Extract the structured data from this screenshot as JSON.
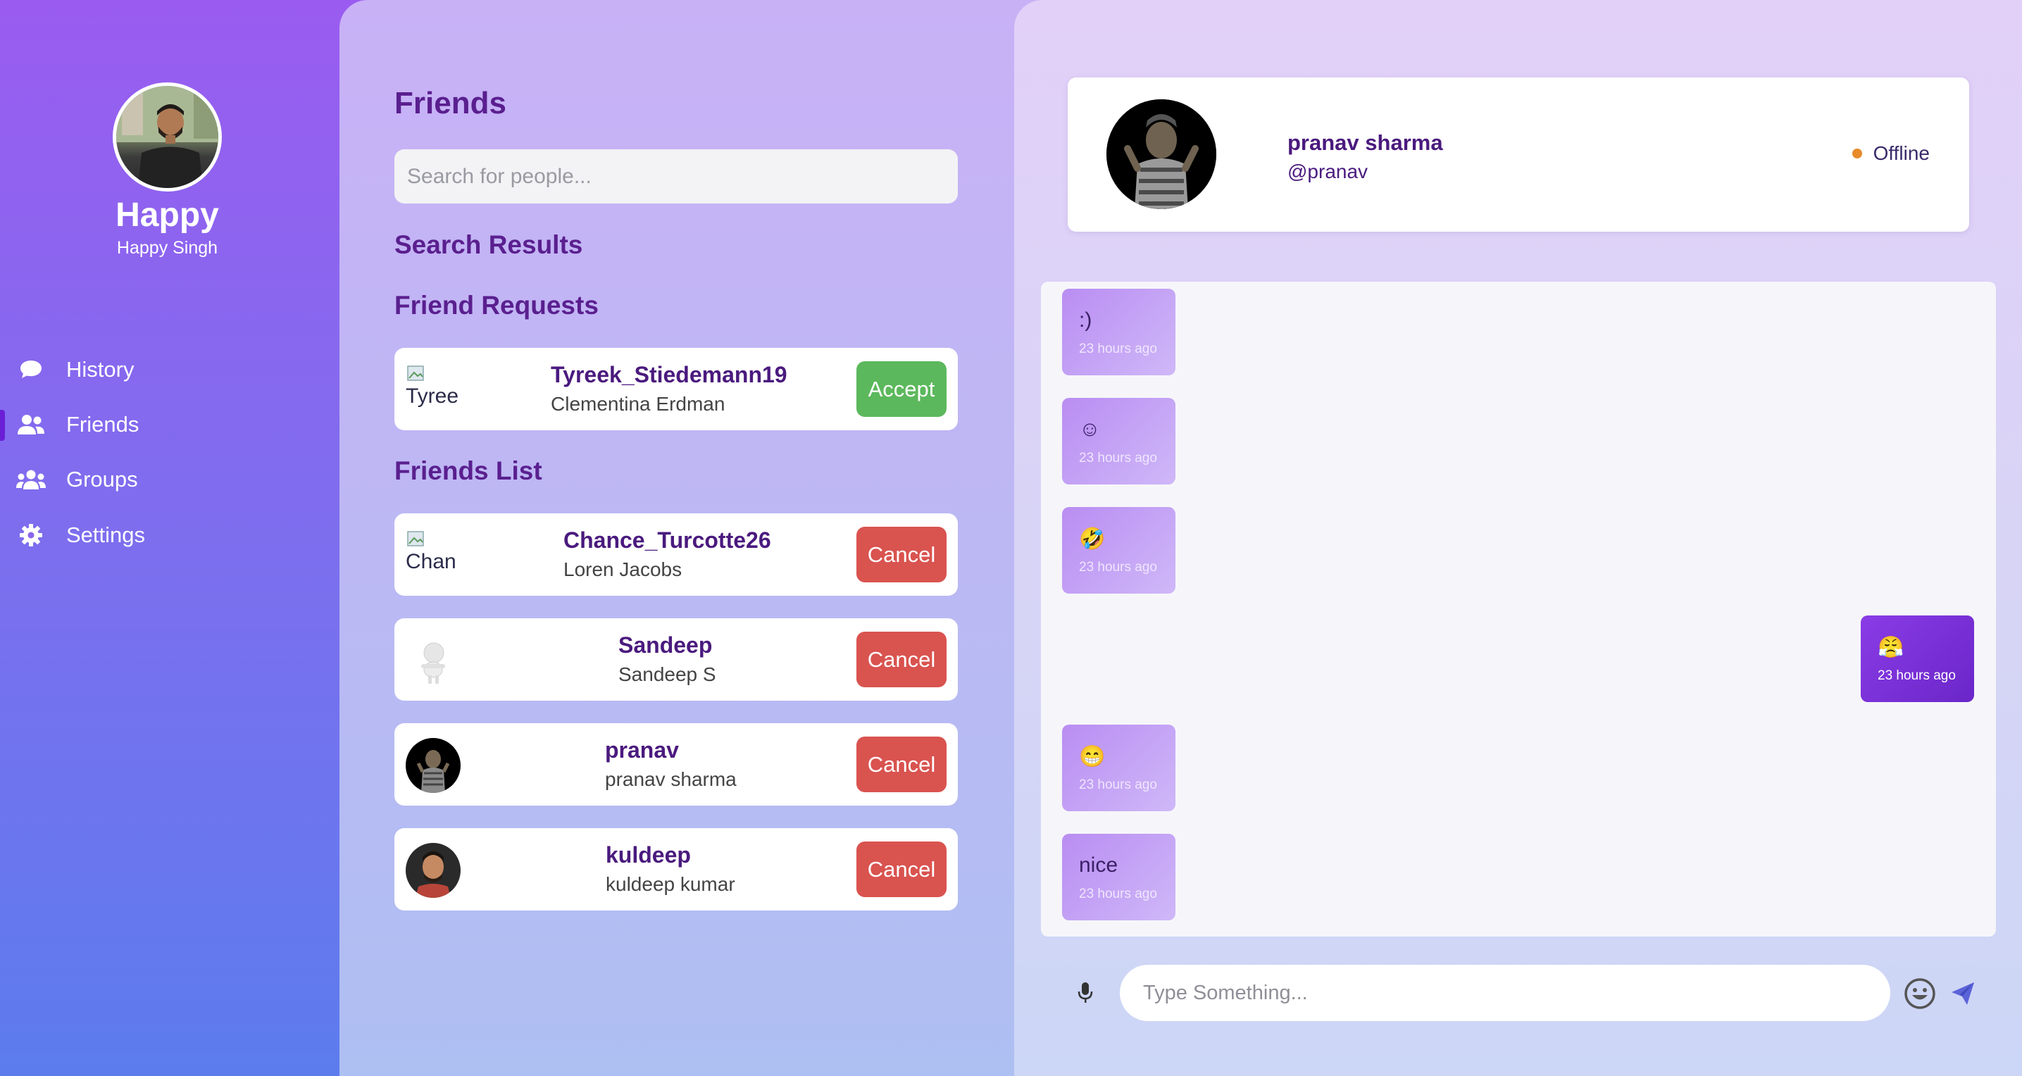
{
  "user": {
    "display_name": "Happy",
    "full_name": "Happy Singh"
  },
  "nav": [
    {
      "label": "History",
      "icon": "chat-bubble-icon"
    },
    {
      "label": "Friends",
      "icon": "user-friends-icon",
      "active": true
    },
    {
      "label": "Groups",
      "icon": "users-icon"
    },
    {
      "label": "Settings",
      "icon": "gear-icon"
    }
  ],
  "friends": {
    "title": "Friends",
    "search_placeholder": "Search for people...",
    "search_results_heading": "Search Results",
    "requests_heading": "Friend Requests",
    "list_heading": "Friends List",
    "requests": [
      {
        "username": "Tyreek_Stiedemann19",
        "name": "Clementina Erdman",
        "alt": "Tyree",
        "action": "Accept"
      }
    ],
    "list": [
      {
        "username": "Chance_Turcotte26",
        "name": "Loren Jacobs",
        "alt": "Chan",
        "action": "Cancel"
      },
      {
        "username": "Sandeep",
        "name": "Sandeep S",
        "action": "Cancel"
      },
      {
        "username": "pranav",
        "name": "pranav sharma",
        "action": "Cancel"
      },
      {
        "username": "kuldeep",
        "name": "kuldeep kumar",
        "action": "Cancel"
      }
    ]
  },
  "chat": {
    "name": "pranav sharma",
    "handle": "@pranav",
    "status": "Offline",
    "status_color": "#e88a2a",
    "messages": [
      {
        "text": ":)",
        "time": "23 hours ago",
        "mine": false
      },
      {
        "text": "☺",
        "time": "23 hours ago",
        "mine": false
      },
      {
        "text": "🤣",
        "time": "23 hours ago",
        "mine": false
      },
      {
        "text": "😤",
        "time": "23 hours ago",
        "mine": true
      },
      {
        "text": "😁",
        "time": "23 hours ago",
        "mine": false
      },
      {
        "text": "nice",
        "time": "23 hours ago",
        "mine": false
      }
    ],
    "input_placeholder": "Type Something..."
  }
}
